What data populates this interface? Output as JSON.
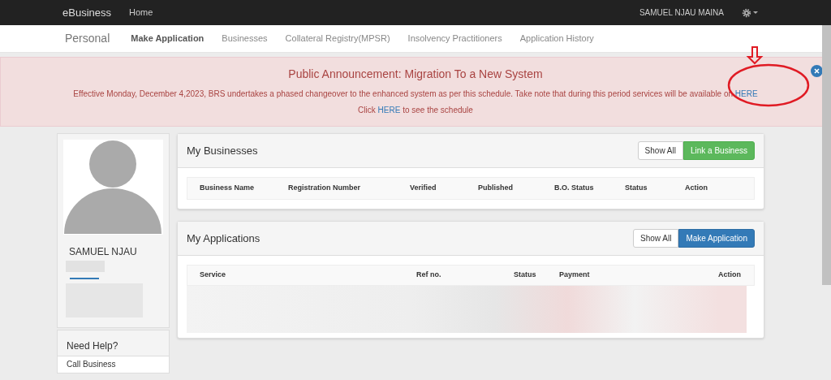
{
  "navbar": {
    "brand": "eBusiness",
    "links": [
      {
        "label": "Home"
      }
    ],
    "user": "SAMUEL NJAU MAINA"
  },
  "subnav": {
    "title": "Personal",
    "tabs": [
      {
        "label": "Make Application",
        "selected": true
      },
      {
        "label": "Businesses",
        "selected": false
      },
      {
        "label": "Collateral Registry(MPSR)",
        "selected": false
      },
      {
        "label": "Insolvency Practitioners",
        "selected": false
      },
      {
        "label": "Application History",
        "selected": false
      }
    ]
  },
  "announcement": {
    "title": "Public Announcement: Migration To a New System",
    "line1": "Effective Monday, December 4,2023, BRS undertakes a phased changeover to the enhanced system as per this schedule. Take note that during this period services will be available on",
    "line1_link": "HERE",
    "line2_before": "Click",
    "line2_link": "HERE",
    "line2_after": "to see the schedule"
  },
  "profile": {
    "name": "SAMUEL NJAU"
  },
  "help": {
    "title": "Need Help?",
    "item": "Call Business"
  },
  "businesses": {
    "title": "My Businesses",
    "buttons": [
      {
        "label": "Show All",
        "kind": "default"
      },
      {
        "label": "Link a Business",
        "kind": "success"
      }
    ],
    "columns": [
      "Business Name",
      "Registration Number",
      "Verified",
      "Published",
      "B.O. Status",
      "Status",
      "Action"
    ]
  },
  "applications": {
    "title": "My Applications",
    "buttons": [
      {
        "label": "Show All",
        "kind": "default"
      },
      {
        "label": "Make Application",
        "kind": "primary"
      }
    ],
    "columns": [
      "Service",
      "Ref no.",
      "Status",
      "Payment",
      "Action"
    ]
  }
}
